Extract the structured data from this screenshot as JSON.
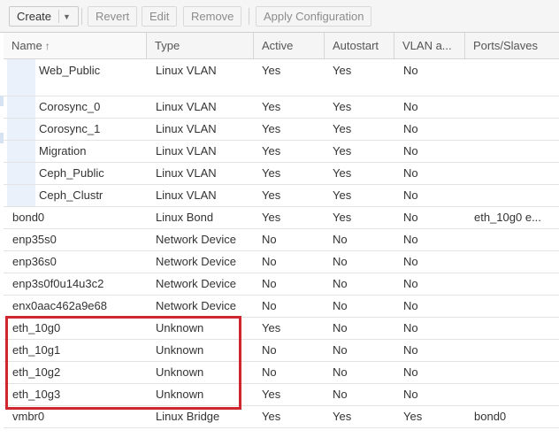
{
  "toolbar": {
    "create": "Create",
    "revert": "Revert",
    "edit": "Edit",
    "remove": "Remove",
    "apply": "Apply Configuration"
  },
  "columns": [
    "Name",
    "Type",
    "Active",
    "Autostart",
    "VLAN a...",
    "Ports/Slaves"
  ],
  "sort": {
    "column": "Name",
    "direction": "ascending"
  },
  "rows": [
    {
      "name": "Web_Public",
      "type": "Linux VLAN",
      "active": "Yes",
      "autostart": "Yes",
      "vlan": "No",
      "ports": ""
    },
    {
      "name": "Corosync_0",
      "type": "Linux VLAN",
      "active": "Yes",
      "autostart": "Yes",
      "vlan": "No",
      "ports": ""
    },
    {
      "name": "Corosync_1",
      "type": "Linux VLAN",
      "active": "Yes",
      "autostart": "Yes",
      "vlan": "No",
      "ports": ""
    },
    {
      "name": "Migration",
      "type": "Linux VLAN",
      "active": "Yes",
      "autostart": "Yes",
      "vlan": "No",
      "ports": ""
    },
    {
      "name": "Ceph_Public",
      "type": "Linux VLAN",
      "active": "Yes",
      "autostart": "Yes",
      "vlan": "No",
      "ports": ""
    },
    {
      "name": "Ceph_Clustr",
      "type": "Linux VLAN",
      "active": "Yes",
      "autostart": "Yes",
      "vlan": "No",
      "ports": ""
    },
    {
      "name": "bond0",
      "type": "Linux Bond",
      "active": "Yes",
      "autostart": "Yes",
      "vlan": "No",
      "ports": "eth_10g0 e..."
    },
    {
      "name": "enp35s0",
      "type": "Network Device",
      "active": "No",
      "autostart": "No",
      "vlan": "No",
      "ports": ""
    },
    {
      "name": "enp36s0",
      "type": "Network Device",
      "active": "No",
      "autostart": "No",
      "vlan": "No",
      "ports": ""
    },
    {
      "name": "enp3s0f0u14u3c2",
      "type": "Network Device",
      "active": "No",
      "autostart": "No",
      "vlan": "No",
      "ports": ""
    },
    {
      "name": "enx0aac462a9e68",
      "type": "Network Device",
      "active": "No",
      "autostart": "No",
      "vlan": "No",
      "ports": ""
    },
    {
      "name": "eth_10g0",
      "type": "Unknown",
      "active": "Yes",
      "autostart": "No",
      "vlan": "No",
      "ports": ""
    },
    {
      "name": "eth_10g1",
      "type": "Unknown",
      "active": "No",
      "autostart": "No",
      "vlan": "No",
      "ports": ""
    },
    {
      "name": "eth_10g2",
      "type": "Unknown",
      "active": "No",
      "autostart": "No",
      "vlan": "No",
      "ports": ""
    },
    {
      "name": "eth_10g3",
      "type": "Unknown",
      "active": "Yes",
      "autostart": "No",
      "vlan": "No",
      "ports": ""
    },
    {
      "name": "vmbr0",
      "type": "Linux Bridge",
      "active": "Yes",
      "autostart": "Yes",
      "vlan": "Yes",
      "ports": "bond0"
    }
  ],
  "colors": {
    "highlight_box": "#d0262f",
    "vlan_name_indent_bg": "#eaf1fa",
    "header_bg": "#f5f5f5"
  },
  "icons": {
    "sort": "sort-up-arrow-icon",
    "dropdown": "chevron-down-icon"
  }
}
